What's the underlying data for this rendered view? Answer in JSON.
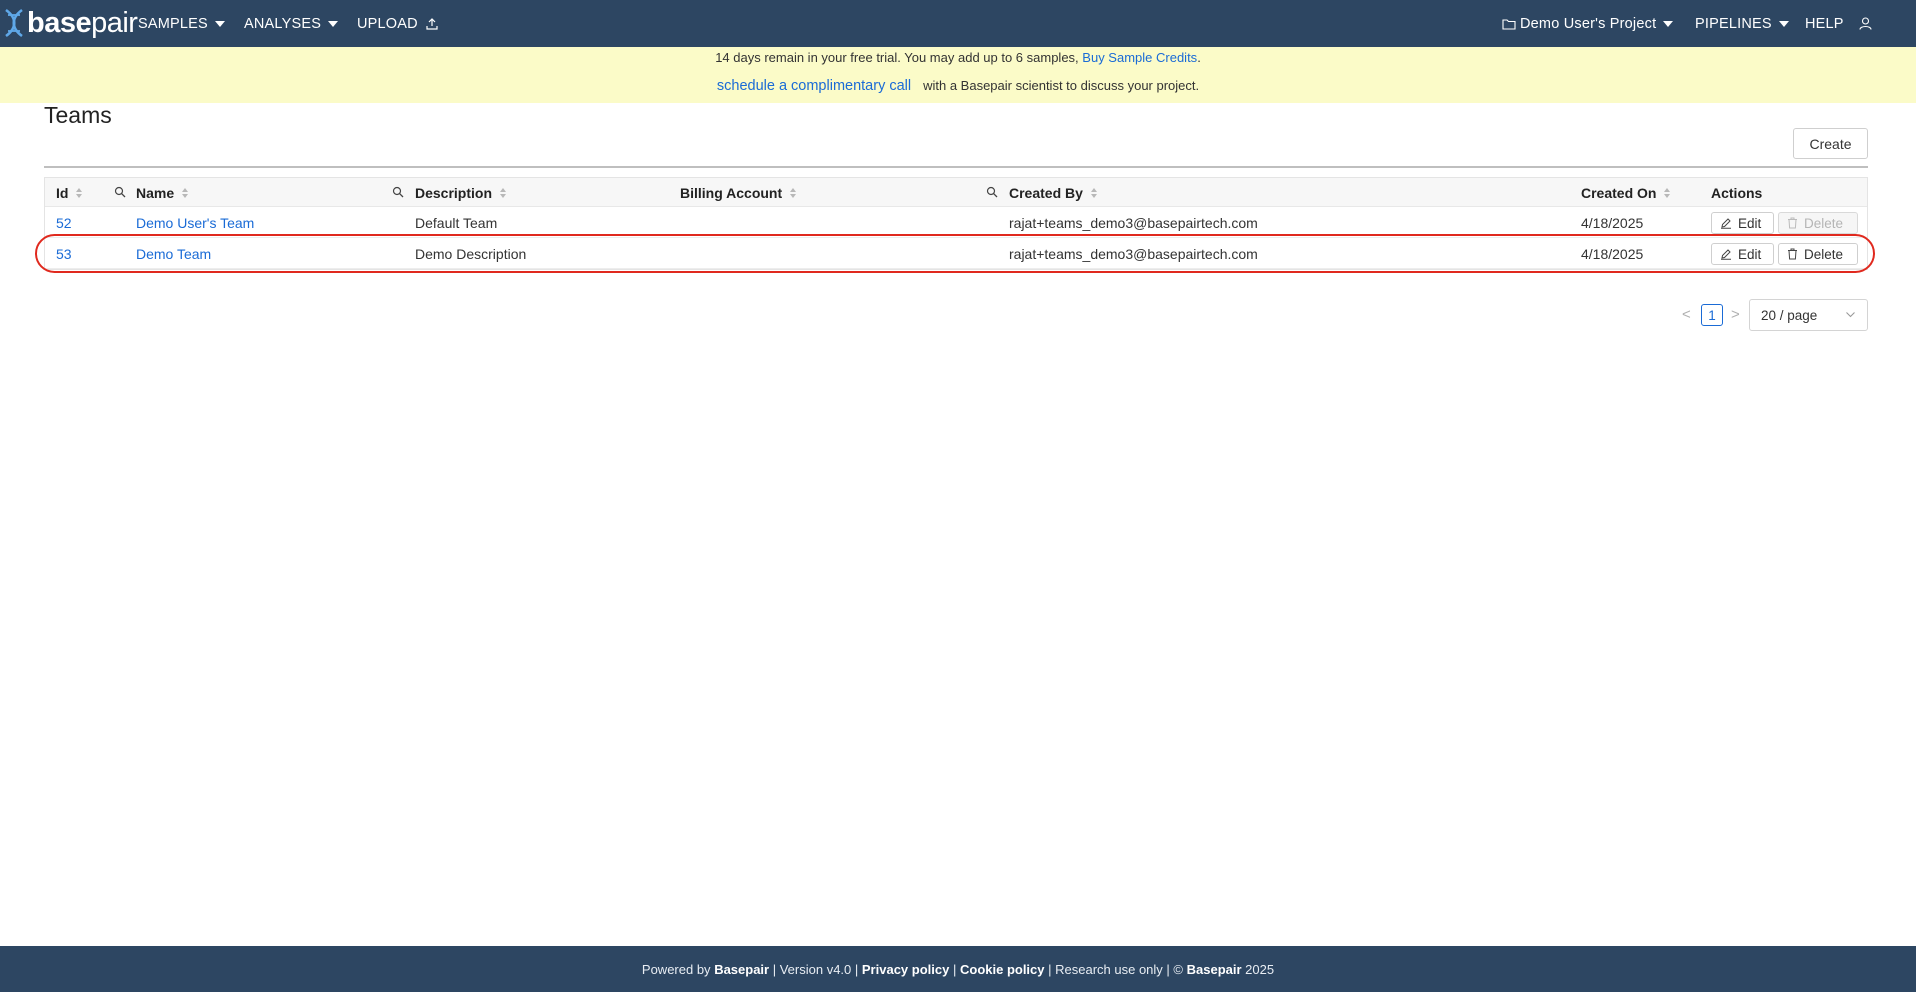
{
  "navbar": {
    "logo": {
      "part1": "base",
      "part2": "pair"
    },
    "items": {
      "samples": "SAMPLES",
      "analyses": "ANALYSES",
      "upload": "UPLOAD",
      "project": "Demo User's Project",
      "pipelines": "PIPELINES",
      "help": "HELP"
    },
    "icons": [
      "dna-logo-icon",
      "upload-icon",
      "folder-icon",
      "user-icon"
    ],
    "background": "#2d4662"
  },
  "banner": {
    "line1_text": "14 days remain in your free trial. You may add up to 6 samples,",
    "line1_link": "Buy Sample Credits",
    "line1_end": ".",
    "line2_link": "schedule a complimentary call",
    "line2_text": "with a Basepair scientist to discuss your project.",
    "background": "#fbfbc8"
  },
  "page": {
    "title": "Teams",
    "create_label": "Create"
  },
  "table": {
    "columns": {
      "id": "Id",
      "name": "Name",
      "description": "Description",
      "billing": "Billing Account",
      "created_by": "Created By",
      "created_on": "Created On",
      "actions": "Actions"
    },
    "rows": [
      {
        "id": "52",
        "name": "Demo User's Team",
        "description": "Default Team",
        "billing": "",
        "created_by": "rajat+teams_demo3@basepairtech.com",
        "created_on": "4/18/2025",
        "edit": "Edit",
        "delete": "Delete",
        "delete_disabled": true
      },
      {
        "id": "53",
        "name": "Demo Team",
        "description": "Demo Description",
        "billing": "",
        "created_by": "rajat+teams_demo3@basepairtech.com",
        "created_on": "4/18/2025",
        "edit": "Edit",
        "delete": "Delete",
        "delete_disabled": false
      }
    ]
  },
  "pagination": {
    "prev": "<",
    "current_page": "1",
    "next": ">",
    "page_size": "20 / page"
  },
  "footer": {
    "powered_by": "Powered by",
    "brand": "Basepair",
    "version": "| Version v4.0 |",
    "privacy": "Privacy policy",
    "sep1": "|",
    "cookie": "Cookie policy",
    "research": "| Research use only | ©",
    "brand2": "Basepair",
    "year": "2025"
  },
  "colors": {
    "accent": "#1a6bd6",
    "highlight_outline": "#e0291e"
  }
}
